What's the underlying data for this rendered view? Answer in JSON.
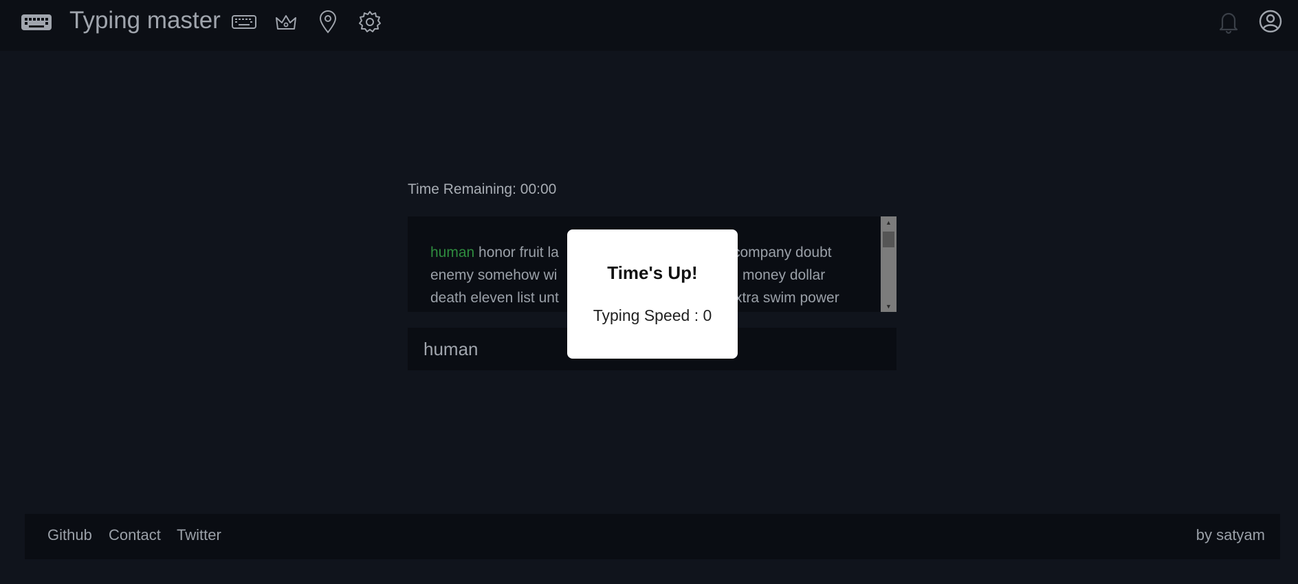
{
  "app": {
    "title": "Typing master"
  },
  "nav": {
    "icons": [
      "keyboard-icon",
      "crown-icon",
      "map-pin-icon",
      "gear-icon"
    ],
    "right_icons": [
      "bell-icon",
      "user-circle-icon"
    ]
  },
  "test": {
    "timer_label": "Time Remaining: 00:00",
    "current_word": "human",
    "text_lines": [
      {
        "rest": " honor fruit la",
        "tail": "company doubt"
      },
      {
        "rest": "enemy somehow wi",
        "tail": "money dollar"
      },
      {
        "rest": "death eleven list unt",
        "tail": "xtra swim power"
      }
    ],
    "input_value": "human"
  },
  "modal": {
    "title": "Time's Up!",
    "speed_text": "Typing Speed : 0"
  },
  "footer": {
    "links": [
      "Github",
      "Contact",
      "Twitter"
    ],
    "credit": "by satyam"
  },
  "colors": {
    "background": "#10141c",
    "topbar": "#0c0f15",
    "panel": "#0a0d13",
    "current_word": "#2e8b3e",
    "modal": "#ffffff"
  }
}
